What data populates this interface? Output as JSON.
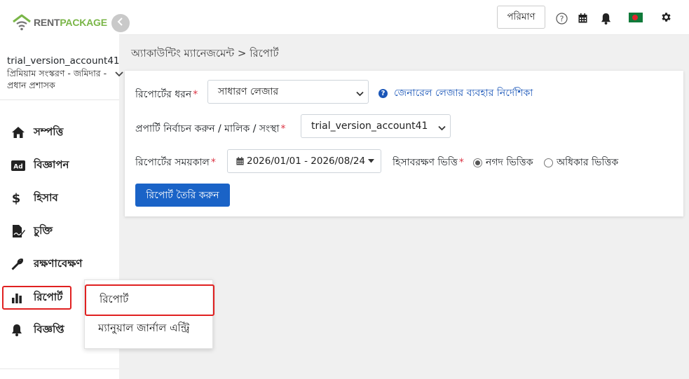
{
  "brand": {
    "part1": "RENT",
    "part2": "PACKAGE"
  },
  "account": {
    "name": "trial_version_account41",
    "role": "প্রিমিয়াম সংস্করণ - জমিদার - প্রধান প্রশাসক"
  },
  "sidebar": {
    "items": [
      {
        "label": "সম্পত্তি",
        "icon": "home-icon"
      },
      {
        "label": "বিজ্ঞাপন",
        "icon": "ad-icon"
      },
      {
        "label": "হিসাব",
        "icon": "dollar-icon"
      },
      {
        "label": "চুক্তি",
        "icon": "contract-icon"
      },
      {
        "label": "রক্ষণাবেক্ষণ",
        "icon": "wrench-icon"
      },
      {
        "label": "রিপোর্ট",
        "icon": "bar-chart-icon"
      },
      {
        "label": "বিজ্ঞপ্তি",
        "icon": "bell-icon"
      }
    ]
  },
  "topbar": {
    "units_label": "পরিমাণ"
  },
  "breadcrumb": "অ্যাকাউন্টিং ম্যানেজমেন্ট > রিপোর্ট",
  "form": {
    "report_type_label": "রিপোর্টের ধরন",
    "report_type_value": "সাধারণ লেজার",
    "help_link": "জেনারেল লেজার ব্যবহার নির্দেশিকা",
    "property_label": "প্রপার্টি নির্বাচন করুন / মালিক / সংস্থা",
    "property_value": "trial_version_account41",
    "period_label": "রিপোর্টের সময়কাল",
    "period_value": "2026/01/01 - 2026/08/24",
    "basis_label": "হিসাবরক্ষণ ভিত্তি",
    "basis_options": [
      "নগদ ভিত্তিক",
      "অধিকার ভিত্তিক"
    ],
    "basis_selected": "নগদ ভিত্তিক",
    "required_mark": "*",
    "submit_label": "রিপোর্ট তৈরি করুন"
  },
  "submenu": {
    "items": [
      "রিপোর্ট",
      "ম্যানুয়াল জার্নাল এন্ট্রি"
    ]
  },
  "colors": {
    "primary": "#1a63c7",
    "brand_green": "#7ab648",
    "highlight": "#e02020"
  }
}
